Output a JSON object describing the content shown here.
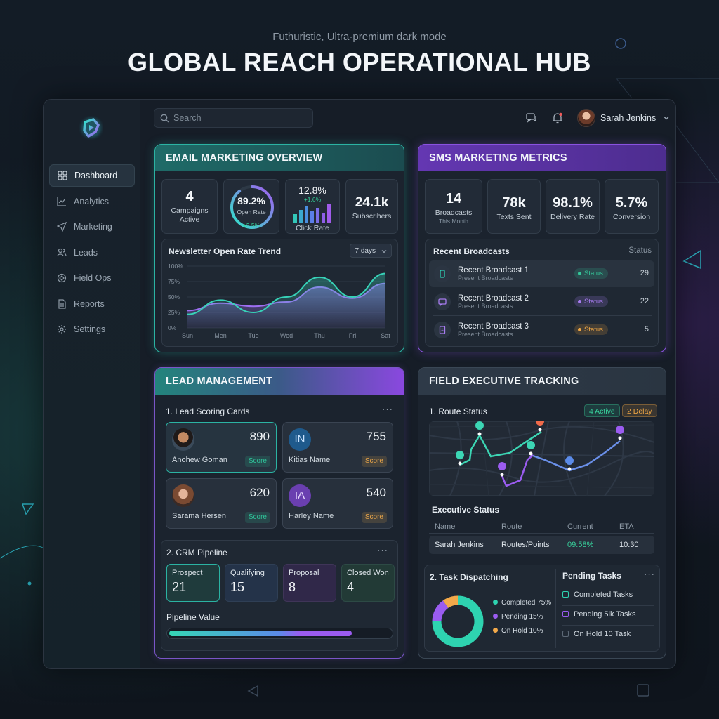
{
  "header": {
    "subtitle": "Futhuristic, Ultra-premium dark mode",
    "title": "GLOBAL REACH OPERATIONAL HUB"
  },
  "sidebar": {
    "items": [
      {
        "label": "Dashboard",
        "icon": "grid-icon",
        "active": true
      },
      {
        "label": "Analytics",
        "icon": "chart-line-icon"
      },
      {
        "label": "Marketing",
        "icon": "send-icon"
      },
      {
        "label": "Leads",
        "icon": "users-icon"
      },
      {
        "label": "Field Ops",
        "icon": "route-icon"
      },
      {
        "label": "Reports",
        "icon": "document-icon"
      },
      {
        "label": "Settings",
        "icon": "gear-icon"
      }
    ]
  },
  "topbar": {
    "search_placeholder": "Search",
    "user_name": "Sarah Jenkins"
  },
  "email": {
    "title": "EMAIL MARKETING OVERVIEW",
    "kpis": {
      "campaigns_value": "4",
      "campaigns_label1": "Campaigns",
      "campaigns_label2": "Active",
      "open_rate_value": "89.2%",
      "open_rate_label": "Open Rate",
      "open_rate_delta": "+3.5%",
      "open_rate_fraction": 0.892,
      "click_rate_value": "12.8%",
      "click_rate_delta": "+1.6%",
      "click_rate_label": "Click Rate",
      "subscribers_value": "24.1k",
      "subscribers_label": "Subscribers"
    },
    "trend_title": "Newsletter Open Rate Trend",
    "trend_range": "7 days"
  },
  "sms": {
    "title": "SMS MARKETING METRICS",
    "kpis": [
      {
        "value": "14",
        "label": "Broadcasts",
        "sub": "This Month"
      },
      {
        "value": "78k",
        "label": "Texts Sent"
      },
      {
        "value": "98.1%",
        "label": "Delivery Rate"
      },
      {
        "value": "5.7%",
        "label": "Conversion"
      }
    ],
    "broadcasts_title": "Recent Broadcasts",
    "status_header": "Status",
    "broadcasts": [
      {
        "title": "Recent Broadcast 1",
        "sub": "Present Broadcasts",
        "status": "Status",
        "count": "29",
        "color": "#34c79a"
      },
      {
        "title": "Recent Broadcast 2",
        "sub": "Present Broadcasts",
        "status": "Status",
        "count": "22",
        "color": "#a77cf0"
      },
      {
        "title": "Recent Broadcast 3",
        "sub": "Present Broadcasts",
        "status": "Status",
        "count": "5",
        "color": "#f0a745"
      }
    ]
  },
  "lead": {
    "title": "LEAD MANAGEMENT",
    "scoring_title": "1. Lead Scoring Cards",
    "cards": [
      {
        "name": "Anohew Goman",
        "score": "890",
        "tag": "Score",
        "tag_color": "#2fc49a"
      },
      {
        "name": "Kitias Name",
        "score": "755",
        "tag": "Score",
        "tag_color": "#e8a54a",
        "initials": "IN"
      },
      {
        "name": "Sarama Hersen",
        "score": "620",
        "tag": "Score",
        "tag_color": "#2fc49a"
      },
      {
        "name": "Harley Name",
        "score": "540",
        "tag": "Score",
        "tag_color": "#e8a54a",
        "initials": "IA"
      }
    ],
    "crm_title": "2. CRM Pipeline",
    "stages": [
      {
        "label": "Prospect",
        "count": "21"
      },
      {
        "label": "Qualifying",
        "count": "15"
      },
      {
        "label": "Proposal",
        "count": "8"
      },
      {
        "label": "Closed Won",
        "count": "4"
      }
    ],
    "pipeline_label": "Pipeline Value",
    "pipeline_progress": 0.82
  },
  "field": {
    "title": "FIELD EXECUTIVE TRACKING",
    "route_title": "1. Route Status",
    "active_badge": "4 Active",
    "delay_badge": "2 Delay",
    "exec_title": "Executive Status",
    "table_headers": [
      "Name",
      "Route",
      "Current",
      "ETA"
    ],
    "table_row": [
      "Sarah Jenkins",
      "Routes/Points",
      "09:58%",
      "10:30"
    ],
    "task_title": "2. Task Dispatching",
    "donut": [
      {
        "label": "Completed 75%",
        "value": 75,
        "color": "#2ed3b0"
      },
      {
        "label": "Pending 15%",
        "value": 15,
        "color": "#9a5cf0"
      },
      {
        "label": "On Hold 10%",
        "value": 10,
        "color": "#f2a94a"
      }
    ],
    "pending_title": "Pending Tasks",
    "pending_items": [
      "Completed Tasks",
      "Pending 5ik Tasks",
      "On Hold 10 Task"
    ]
  },
  "chart_data": {
    "type": "line",
    "title": "Newsletter Open Rate Trend",
    "categories": [
      "Sun",
      "Men",
      "Tue",
      "Wed",
      "Thu",
      "Fri",
      "Sat"
    ],
    "y_ticks": [
      "100%",
      "75%",
      "50%",
      "25%",
      "0%"
    ],
    "ylim": [
      0,
      100
    ],
    "series": [
      {
        "values": [
          22,
          45,
          25,
          50,
          82,
          50,
          88
        ],
        "color": "#37d3b8"
      },
      {
        "values": [
          28,
          40,
          35,
          42,
          66,
          48,
          72
        ],
        "color": "#9d6ff2"
      }
    ]
  }
}
